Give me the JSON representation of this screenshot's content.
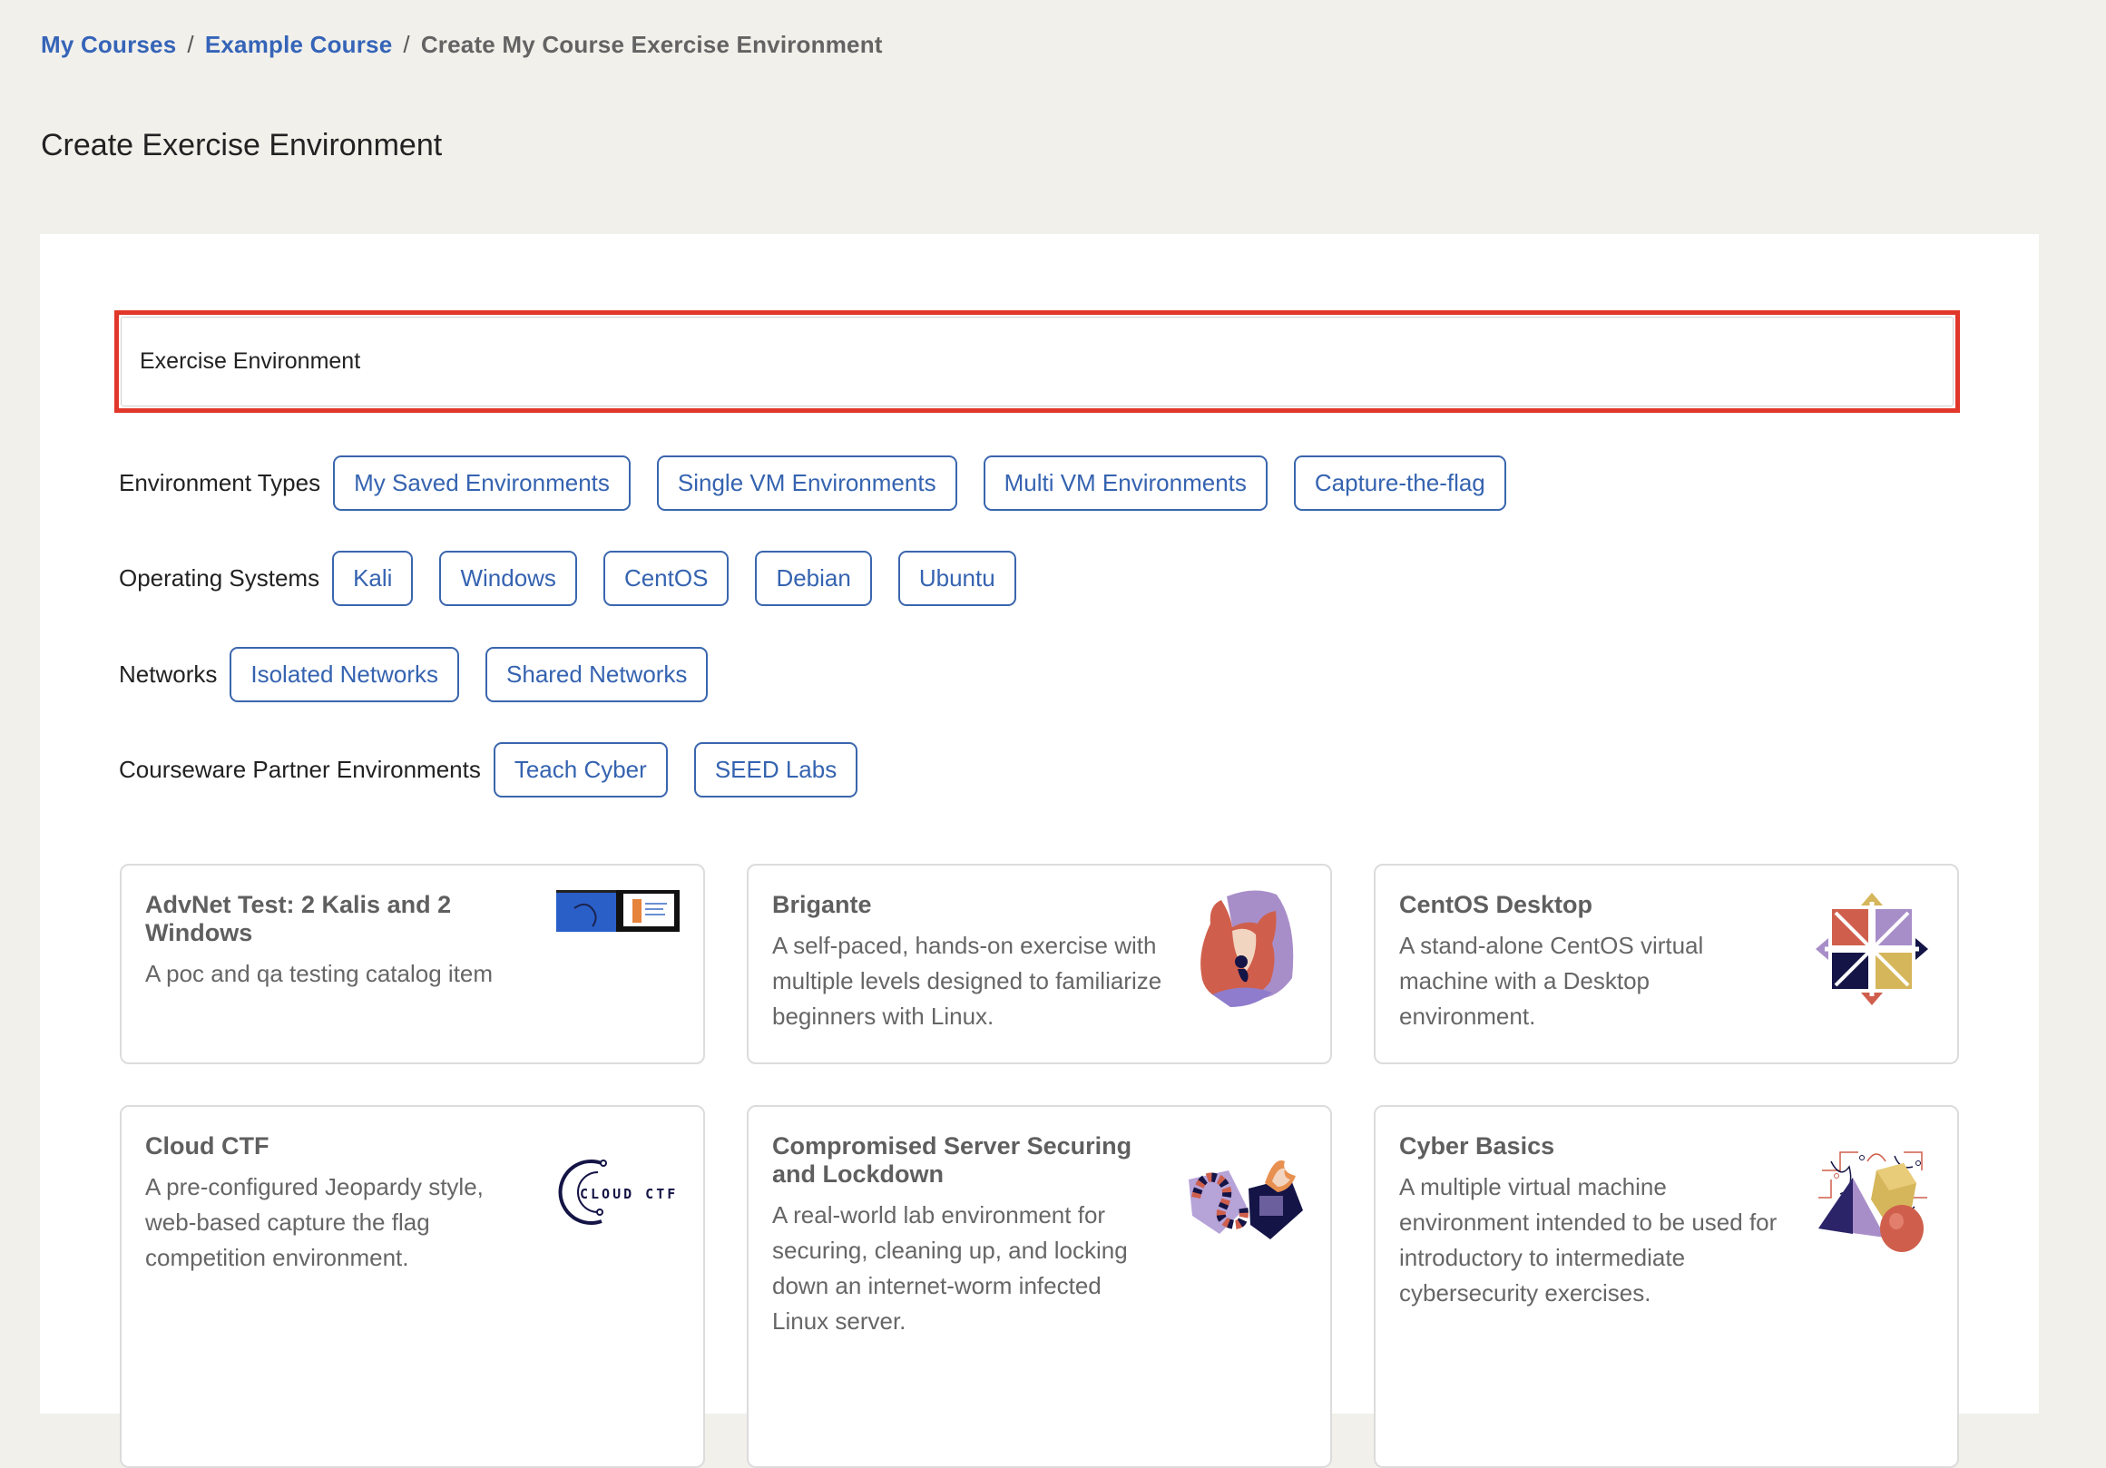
{
  "breadcrumb": {
    "items": [
      {
        "label": "My Courses",
        "link": true
      },
      {
        "label": "Example Course",
        "link": true
      },
      {
        "label": "Create My Course Exercise Environment",
        "link": false
      }
    ],
    "separator": "/"
  },
  "page": {
    "title": "Create Exercise Environment"
  },
  "search": {
    "value": "Exercise Environment",
    "highlight_color": "#e0372a"
  },
  "filters": [
    {
      "label": "Environment Types",
      "options": [
        "My Saved Environments",
        "Single VM Environments",
        "Multi VM Environments",
        "Capture-the-flag"
      ]
    },
    {
      "label": "Operating Systems",
      "options": [
        "Kali",
        "Windows",
        "CentOS",
        "Debian",
        "Ubuntu"
      ]
    },
    {
      "label": "Networks",
      "options": [
        "Isolated Networks",
        "Shared Networks"
      ]
    },
    {
      "label": "Courseware Partner Environments",
      "options": [
        "Teach Cyber",
        "SEED Labs"
      ]
    }
  ],
  "cards": [
    {
      "title": "AdvNet Test: 2 Kalis and 2 Windows",
      "description": "A poc and qa testing catalog item",
      "icon": "desktop-screenshot-icon"
    },
    {
      "title": "Brigante",
      "description": "A self-paced, hands-on exercise with multiple levels designed to familiarize beginners with Linux.",
      "icon": "dog-mascot-icon"
    },
    {
      "title": "CentOS Desktop",
      "description": "A stand-alone CentOS virtual machine with a Desktop environment.",
      "icon": "centos-logo-icon"
    },
    {
      "title": "Cloud CTF",
      "description": "A pre-configured Jeopardy style, web-based capture the flag competition environment.",
      "icon": "cloud-ctf-logo-icon",
      "logo_text": "CLOUD CTF"
    },
    {
      "title": "Compromised Server Securing and Lockdown",
      "description": "A real-world lab environment for securing, cleaning up, and locking down an internet-worm infected Linux server.",
      "icon": "worm-server-icon"
    },
    {
      "title": "Cyber Basics",
      "description": "A multiple virtual machine environment intended to be used for introductory to intermediate cybersecurity exercises.",
      "icon": "geometric-shapes-icon"
    }
  ],
  "colors": {
    "link": "#3564b8",
    "pill_border": "#3a66ad",
    "background": "#f1f0eb"
  }
}
